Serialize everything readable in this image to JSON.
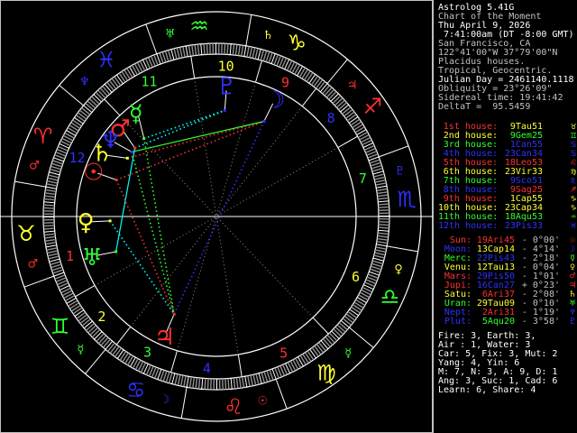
{
  "colors": {
    "fire": "#ff3030",
    "earth": "#ffff30",
    "air": "#30ff30",
    "water": "#3030ff",
    "white": "#ffffff",
    "gray": "#c0c0c0"
  },
  "header": [
    {
      "text": "Astrolog 5.41G",
      "bright": true
    },
    {
      "text": "Chart of the Moment",
      "bright": false
    },
    {
      "text": "Thu April 9, 2026",
      "bright": true
    },
    {
      "text": " 7:41:00am (DT -8:00 GMT)",
      "bright": true
    },
    {
      "text": "San Francisco, CA",
      "bright": false
    },
    {
      "text": "122°41'00\"W 37°79'00\"N",
      "bright": false
    },
    {
      "text": "Placidus houses.",
      "bright": false
    },
    {
      "text": "Tropical, Geocentric.",
      "bright": false
    },
    {
      "text": "Julian Day = 2461140.1118",
      "bright": true
    },
    {
      "text": "Obliquity = 23°26'09\"",
      "bright": false
    },
    {
      "text": "Sidereal time: 19:41:42",
      "bright": false
    },
    {
      "text": "DeltaT =  95.5459",
      "bright": false
    }
  ],
  "signs": [
    {
      "name": "Aries",
      "glyph": "♈",
      "el": "fire",
      "ruler": "♂",
      "rulerColor": "fire"
    },
    {
      "name": "Taurus",
      "glyph": "♉",
      "el": "earth",
      "ruler": "♂",
      "rulerColor": "fire"
    },
    {
      "name": "Gemini",
      "glyph": "♊",
      "el": "air",
      "ruler": "☿",
      "rulerColor": "air"
    },
    {
      "name": "Cancer",
      "glyph": "♋",
      "el": "water",
      "ruler": "☽",
      "rulerColor": "water"
    },
    {
      "name": "Leo",
      "glyph": "♌",
      "el": "fire",
      "ruler": "☉",
      "rulerColor": "fire"
    },
    {
      "name": "Virgo",
      "glyph": "♍",
      "el": "earth",
      "ruler": "☿",
      "rulerColor": "air"
    },
    {
      "name": "Libra",
      "glyph": "♎",
      "el": "air",
      "ruler": "♀",
      "rulerColor": "earth"
    },
    {
      "name": "Scorpio",
      "glyph": "♏",
      "el": "water",
      "ruler": "♇",
      "rulerColor": "water"
    },
    {
      "name": "Sagittarius",
      "glyph": "♐",
      "el": "fire",
      "ruler": "♃",
      "rulerColor": "fire"
    },
    {
      "name": "Capricorn",
      "glyph": "♑",
      "el": "earth",
      "ruler": "♄",
      "rulerColor": "earth"
    },
    {
      "name": "Aquarius",
      "glyph": "♒",
      "el": "air",
      "ruler": "♅",
      "rulerColor": "air"
    },
    {
      "name": "Pisces",
      "glyph": "♓",
      "el": "water",
      "ruler": "♆",
      "rulerColor": "water"
    }
  ],
  "houses": [
    {
      "label": "1st house:",
      "value": "9Tau51",
      "lon": 39.85,
      "el": "fire",
      "signEl": "earth",
      "glyph": "♉"
    },
    {
      "label": "2nd house:",
      "value": "9Gem25",
      "lon": 69.42,
      "el": "earth",
      "signEl": "air",
      "glyph": "♊"
    },
    {
      "label": "3rd house:",
      "value": "1Can55",
      "lon": 91.92,
      "el": "air",
      "signEl": "water",
      "glyph": "♋"
    },
    {
      "label": "4th house:",
      "value": "23Can34",
      "lon": 113.57,
      "el": "water",
      "signEl": "water",
      "glyph": "♋"
    },
    {
      "label": "5th house:",
      "value": "18Leo53",
      "lon": 138.88,
      "el": "fire",
      "signEl": "fire",
      "glyph": "♌"
    },
    {
      "label": "6th house:",
      "value": "23Vir33",
      "lon": 173.55,
      "el": "earth",
      "signEl": "earth",
      "glyph": "♍"
    },
    {
      "label": "7th house:",
      "value": "9Sco51",
      "lon": 219.85,
      "el": "air",
      "signEl": "water",
      "glyph": "♏"
    },
    {
      "label": "8th house:",
      "value": "9Sag25",
      "lon": 249.42,
      "el": "water",
      "signEl": "fire",
      "glyph": "♐"
    },
    {
      "label": "9th house:",
      "value": "1Cap55",
      "lon": 271.92,
      "el": "fire",
      "signEl": "earth",
      "glyph": "♑"
    },
    {
      "label": "10th house:",
      "value": "23Cap34",
      "lon": 293.57,
      "el": "earth",
      "signEl": "earth",
      "glyph": "♑"
    },
    {
      "label": "11th house:",
      "value": "18Aqu53",
      "lon": 318.88,
      "el": "air",
      "signEl": "air",
      "glyph": "♒"
    },
    {
      "label": "12th house:",
      "value": "23Pis33",
      "lon": 353.55,
      "el": "water",
      "signEl": "water",
      "glyph": "♓"
    }
  ],
  "houseNumbers": [
    "1",
    "2",
    "3",
    "4",
    "5",
    "6",
    "7",
    "8",
    "9",
    "10",
    "11",
    "12"
  ],
  "planets": [
    {
      "label": "Sun:",
      "value": "19Ari45",
      "speed": "- 0°00'",
      "glyph": "☉",
      "lon": 19.75,
      "color": "fire",
      "signEl": "fire"
    },
    {
      "label": "Moon:",
      "value": "13Cap14",
      "speed": "- 4°14'",
      "glyph": "☽",
      "lon": 283.23,
      "color": "water",
      "signEl": "earth"
    },
    {
      "label": "Merc:",
      "value": "22Pis43",
      "speed": "- 2°18'",
      "glyph": "☿",
      "lon": 352.72,
      "color": "air",
      "signEl": "water"
    },
    {
      "label": "Venu:",
      "value": "12Tau13",
      "speed": "- 0°04'",
      "glyph": "♀",
      "lon": 42.22,
      "color": "earth",
      "signEl": "earth"
    },
    {
      "label": "Mars:",
      "value": "29Pis50",
      "speed": "- 1°01'",
      "glyph": "♂",
      "lon": 359.83,
      "color": "fire",
      "signEl": "water"
    },
    {
      "label": "Jupi:",
      "value": "16Can27",
      "speed": "+ 0°23'",
      "glyph": "♃",
      "lon": 106.45,
      "color": "fire",
      "signEl": "water"
    },
    {
      "label": "Satu:",
      "value": "6Ari37",
      "speed": "- 2°08'",
      "glyph": "♄",
      "lon": 6.62,
      "color": "earth",
      "signEl": "fire"
    },
    {
      "label": "Uran:",
      "value": "29Tau09",
      "speed": "- 0°10'",
      "glyph": "♅",
      "lon": 59.15,
      "color": "air",
      "signEl": "earth"
    },
    {
      "label": "Nept:",
      "value": "2Ari31",
      "speed": "- 1°19'",
      "glyph": "♆",
      "lon": 2.52,
      "color": "water",
      "signEl": "fire"
    },
    {
      "label": "Plut:",
      "value": "5Aqu20",
      "speed": "- 3°58'",
      "glyph": "♇",
      "lon": 305.33,
      "color": "water",
      "signEl": "air"
    }
  ],
  "aspects": [
    {
      "a": 2,
      "b": 9,
      "color": "#00ffff",
      "style": "dotted"
    },
    {
      "a": 4,
      "b": 9,
      "color": "#00ffff",
      "style": "dotted"
    },
    {
      "a": 6,
      "b": 1,
      "color": "#ff3030",
      "style": "dotted"
    },
    {
      "a": 0,
      "b": 1,
      "color": "#ff3030",
      "style": "dotted"
    },
    {
      "a": 8,
      "b": 1,
      "color": "#30ff30",
      "style": "solid"
    },
    {
      "a": 7,
      "b": 4,
      "color": "#00ffff",
      "style": "solid"
    },
    {
      "a": 0,
      "b": 5,
      "color": "#ff3030",
      "style": "dotted"
    },
    {
      "a": 1,
      "b": 5,
      "color": "#3030ff",
      "style": "dotted"
    },
    {
      "a": 3,
      "b": 5,
      "color": "#00ffff",
      "style": "dotted"
    },
    {
      "a": 2,
      "b": 5,
      "color": "#30ff30",
      "style": "dotted"
    },
    {
      "a": 8,
      "b": 5,
      "color": "#30ff30",
      "style": "dotted"
    }
  ],
  "summary": [
    "Fire: 3, Earth: 3,",
    "Air : 1, Water: 3",
    "Car: 5, Fix: 3, Mut: 2",
    "Yang: 4, Yin: 6",
    "M: 7, N: 3, A: 9, D: 1",
    "Ang: 3, Suc: 1, Cad: 6",
    "Learn: 6, Share: 4"
  ]
}
